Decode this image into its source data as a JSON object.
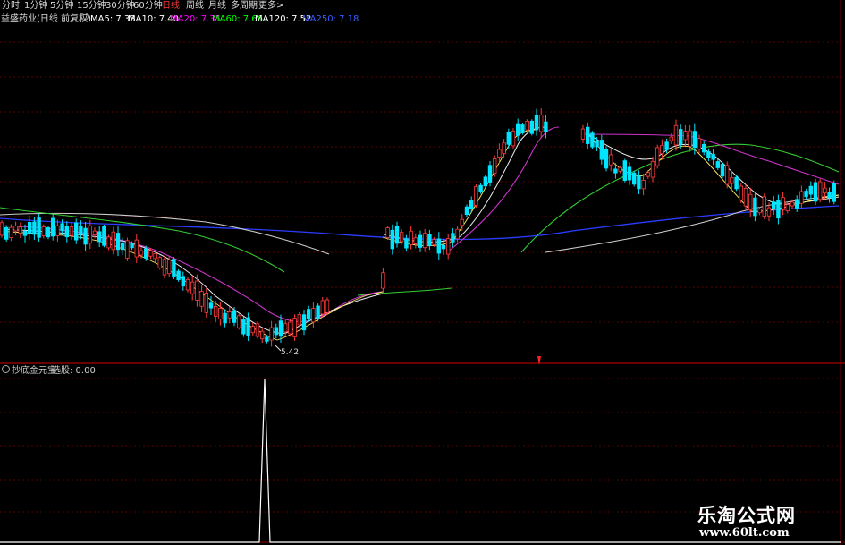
{
  "toolbar": {
    "items": [
      "分时",
      "1分钟",
      "5分钟",
      "15分钟",
      "30分钟",
      "60分钟",
      "日线",
      "周线",
      "月线",
      "多周期",
      "更多>"
    ],
    "active_index": 6,
    "active_color": "#ff3b3b"
  },
  "legend": {
    "stock": "益盛药业(日线 前复权)",
    "ma": [
      {
        "label": "MA5: 7.38",
        "color": "#ffffff"
      },
      {
        "label": "MA10: 7.40",
        "color": "#ffffff"
      },
      {
        "label": "MA20: 7.35",
        "color": "#ff00ff"
      },
      {
        "label": "MA60: 7.66",
        "color": "#00ff00"
      },
      {
        "label": "MA120: 7.52",
        "color": "#ffffff"
      },
      {
        "label": "MA250: 7.18",
        "color": "#3a5bff"
      }
    ]
  },
  "main_chart": {
    "low_label": "5.42",
    "up_color": "#ff3b3b",
    "down_color": "#00e5ff"
  },
  "sub_indicator": {
    "name": "抄底金元宝",
    "value_label": "选股: 0.00",
    "signal_color": "#ffffff"
  },
  "watermark": {
    "title": "乐淘公式网",
    "url": "www.60lt.com"
  }
}
